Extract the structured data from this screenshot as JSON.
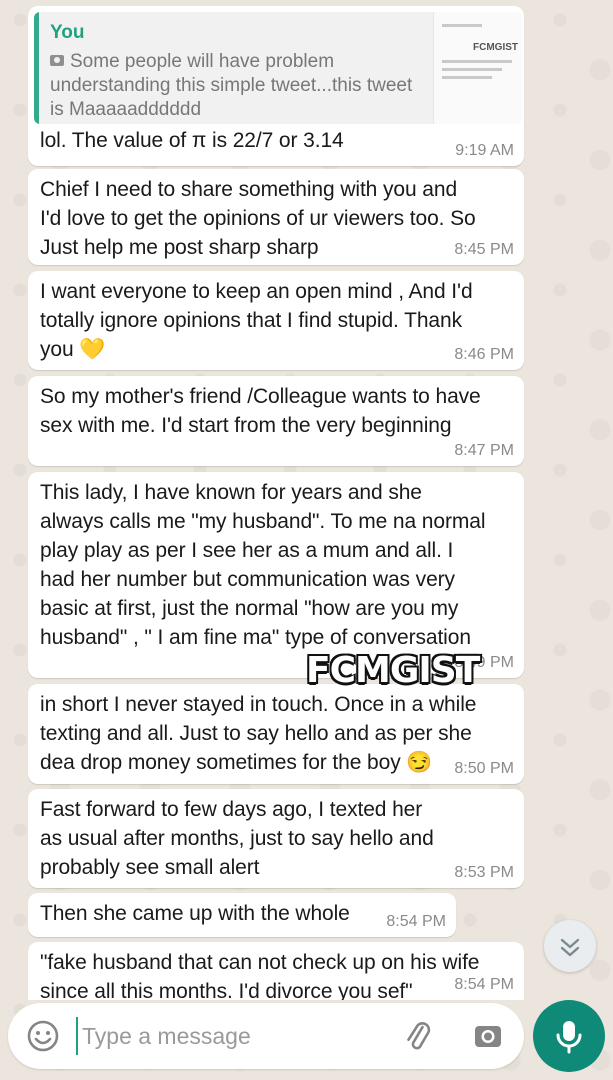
{
  "quote": {
    "author": "You",
    "body": "Some people will have problem understanding this simple tweet...this tweet is Maaaaadddddd",
    "thumbnail_brand": "FCMGIST"
  },
  "messages": [
    {
      "text": "lol.  The value of π is 22/7 or 3.14",
      "time": "9:19 AM"
    },
    {
      "text": "Chief I need to share something with you and\nI'd love to get the opinions of ur viewers too. So\nJust help me post sharp sharp",
      "time": "8:45 PM"
    },
    {
      "text": "I want everyone to keep an open mind , And I'd\ntotally ignore opinions that I find stupid. Thank\nyou 💛",
      "time": "8:46 PM"
    },
    {
      "text": "So my mother's friend /Colleague wants to have\nsex with me. I'd start from the very beginning",
      "time": "8:47 PM"
    },
    {
      "text": "This lady, I have known for years and she\nalways calls me \"my husband\". To me na normal\nplay play as per I see her as a mum and all. I\nhad her number but communication was very\nbasic at first, just the normal \"how are you my\nhusband\" , \" I am fine ma\"  type of conversation",
      "time": "8:49 PM"
    },
    {
      "text": "in short I never stayed in  touch. Once in a while\ntexting and all. Just to say hello and as per she\ndea drop money sometimes for the boy 😏",
      "time": "8:50 PM"
    },
    {
      "text": "Fast forward to few days ago, I texted her\nas usual after months, just to say hello and\nprobably see small alert",
      "time": "8:53 PM"
    },
    {
      "text": "Then she came up with the whole",
      "time": "8:54 PM"
    },
    {
      "text": "\"fake husband that can not check up on his wife\nsince all this months. I'd divorce you sef\"",
      "time": "8:54 PM"
    }
  ],
  "watermark": "FCMGIST",
  "composer": {
    "placeholder": "Type a message"
  },
  "colors": {
    "accent": "#0f8a78",
    "quote_author": "#23a07f",
    "background": "#ece5dd"
  }
}
